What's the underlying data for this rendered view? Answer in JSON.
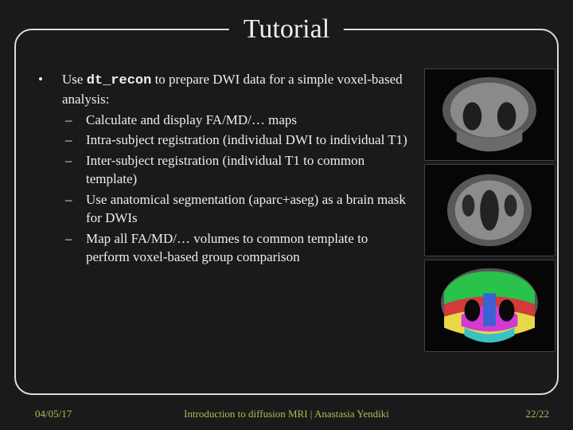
{
  "title": "Tutorial",
  "bullet": {
    "intro_pre": "Use ",
    "intro_code": "dt_recon",
    "intro_post": " to prepare DWI data for a simple voxel-based analysis:",
    "items": [
      "Calculate and display FA/MD/… maps",
      "Intra-subject registration (individual DWI to individual T1)",
      "Inter-subject registration (individual T1 to common template)",
      "Use anatomical segmentation (aparc+aseg) as a brain mask for DWIs",
      "Map all FA/MD/… volumes to common template to perform voxel-based group comparison"
    ]
  },
  "footer": {
    "date": "04/05/17",
    "center": "Introduction to diffusion MRI | Anastasia Yendiki",
    "page": "22/22"
  },
  "images": [
    {
      "label": "coronal-brain-t1"
    },
    {
      "label": "axial-brain-t1"
    },
    {
      "label": "coronal-brain-aparc"
    }
  ]
}
